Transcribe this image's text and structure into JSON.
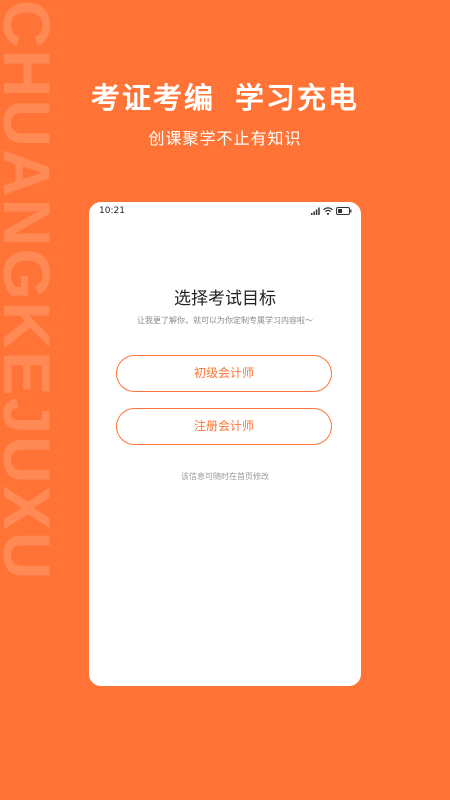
{
  "background": {
    "watermark": "CHUANGKEJUXU",
    "color": "#FF7436"
  },
  "hero": {
    "headline_left": "考证考编",
    "headline_right": "学习充电",
    "subline": "创课聚学不止有知识"
  },
  "phone": {
    "status": {
      "time": "10:21",
      "icons": [
        "signal-icon",
        "wifi-icon",
        "battery-icon"
      ]
    },
    "title": "选择考试目标",
    "description": "让我更了解你，就可以为你定制专属学习内容啦～",
    "options": [
      {
        "label": "初级会计师"
      },
      {
        "label": "注册会计师"
      }
    ],
    "note": "该信息可随时在首页修改"
  },
  "colors": {
    "accent": "#FF7436",
    "title_text": "#222222",
    "muted_text": "#8A8A8A"
  }
}
